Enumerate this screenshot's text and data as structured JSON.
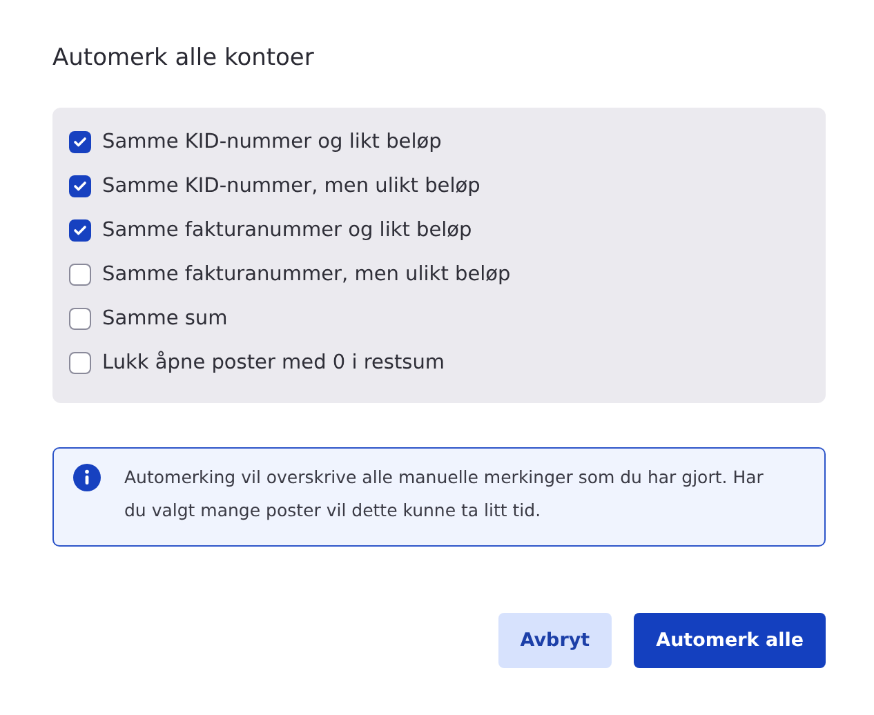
{
  "title": "Automerk alle kontoer",
  "options": [
    {
      "label": "Samme KID-nummer og likt beløp",
      "checked": true
    },
    {
      "label": "Samme KID-nummer, men ulikt beløp",
      "checked": true
    },
    {
      "label": "Samme fakturanummer og likt beløp",
      "checked": true
    },
    {
      "label": "Samme fakturanummer, men ulikt beløp",
      "checked": false
    },
    {
      "label": "Samme sum",
      "checked": false
    },
    {
      "label": "Lukk åpne poster med 0 i restsum",
      "checked": false
    }
  ],
  "info": "Automerking vil overskrive alle manuelle merkinger som du har gjort. Har du valgt mange poster vil dette kunne ta litt tid.",
  "buttons": [
    {
      "label": "Avbryt",
      "kind": "secondary"
    },
    {
      "label": "Automerk alle",
      "kind": "primary"
    }
  ]
}
